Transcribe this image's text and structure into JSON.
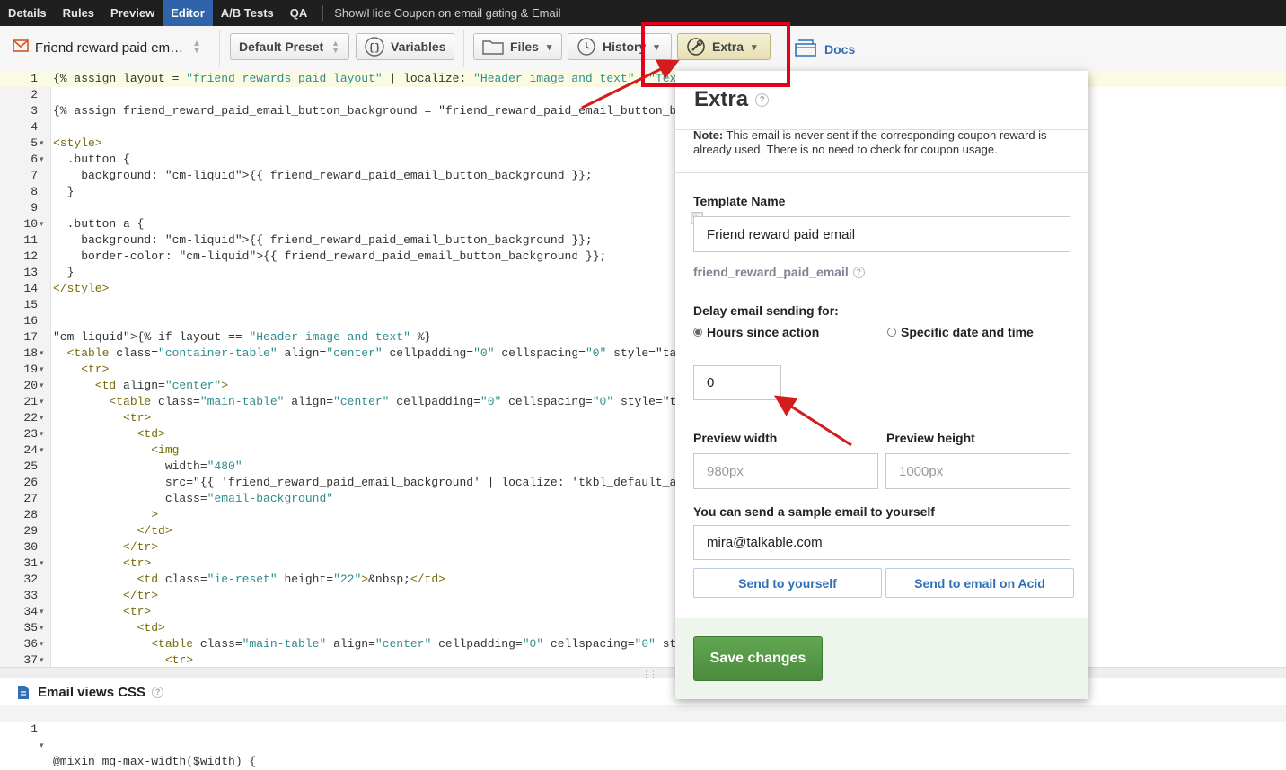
{
  "topnav": {
    "tabs": [
      "Details",
      "Rules",
      "Preview",
      "Editor",
      "A/B Tests",
      "QA"
    ],
    "active": "Editor",
    "campaign_title": "Show/Hide Coupon on email gating & Email"
  },
  "toolbar": {
    "template_select": "Friend reward paid em…",
    "preset_label": "Default Preset",
    "variables_label": "Variables",
    "files_label": "Files",
    "history_label": "History",
    "extra_label": "Extra",
    "docs_label": "Docs"
  },
  "editor": {
    "lines": [
      {
        "n": 1,
        "fold": false,
        "code": "{% assign layout = \"friend_rewards_paid_layout\" | localize: \"Header image and text\", \"Text only\""
      },
      {
        "n": 2,
        "fold": false,
        "code": ""
      },
      {
        "n": 3,
        "fold": false,
        "code": "{% assign friend_reward_paid_email_button_background = \"friend_reward_paid_email_button_backgroun"
      },
      {
        "n": 4,
        "fold": false,
        "code": ""
      },
      {
        "n": 5,
        "fold": true,
        "code": "<style>"
      },
      {
        "n": 6,
        "fold": true,
        "code": "  .button {"
      },
      {
        "n": 7,
        "fold": false,
        "code": "    background: {{ friend_reward_paid_email_button_background }};"
      },
      {
        "n": 8,
        "fold": false,
        "code": "  }"
      },
      {
        "n": 9,
        "fold": false,
        "code": ""
      },
      {
        "n": 10,
        "fold": true,
        "code": "  .button a {"
      },
      {
        "n": 11,
        "fold": false,
        "code": "    background: {{ friend_reward_paid_email_button_background }};"
      },
      {
        "n": 12,
        "fold": false,
        "code": "    border-color: {{ friend_reward_paid_email_button_background }};"
      },
      {
        "n": 13,
        "fold": false,
        "code": "  }"
      },
      {
        "n": 14,
        "fold": false,
        "code": "</style>"
      },
      {
        "n": 15,
        "fold": false,
        "code": ""
      },
      {
        "n": 16,
        "fold": false,
        "code": ""
      },
      {
        "n": 17,
        "fold": false,
        "code": "{% if layout == \"Header image and text\" %}"
      },
      {
        "n": 18,
        "fold": true,
        "code": "  <table class=\"container-table\" align=\"center\" cellpadding=\"0\" cellspacing=\"0\" style=\"table-layo"
      },
      {
        "n": 19,
        "fold": true,
        "code": "    <tr>"
      },
      {
        "n": 20,
        "fold": true,
        "code": "      <td align=\"center\">"
      },
      {
        "n": 21,
        "fold": true,
        "code": "        <table class=\"main-table\" align=\"center\" cellpadding=\"0\" cellspacing=\"0\" style=\"table-lay"
      },
      {
        "n": 22,
        "fold": true,
        "code": "          <tr>"
      },
      {
        "n": 23,
        "fold": true,
        "code": "            <td>"
      },
      {
        "n": 24,
        "fold": true,
        "code": "              <img"
      },
      {
        "n": 25,
        "fold": false,
        "code": "                width=\"480\""
      },
      {
        "n": 26,
        "fold": false,
        "code": "                src=\"{{ 'friend_reward_paid_email_background' | localize: 'tkbl_default_advocate-"
      },
      {
        "n": 27,
        "fold": false,
        "code": "                class=\"email-background\""
      },
      {
        "n": 28,
        "fold": false,
        "code": "              >"
      },
      {
        "n": 29,
        "fold": false,
        "code": "            </td>"
      },
      {
        "n": 30,
        "fold": false,
        "code": "          </tr>"
      },
      {
        "n": 31,
        "fold": true,
        "code": "          <tr>"
      },
      {
        "n": 32,
        "fold": false,
        "code": "            <td class=\"ie-reset\" height=\"22\">&nbsp;</td>"
      },
      {
        "n": 33,
        "fold": false,
        "code": "          </tr>"
      },
      {
        "n": 34,
        "fold": true,
        "code": "          <tr>"
      },
      {
        "n": 35,
        "fold": true,
        "code": "            <td>"
      },
      {
        "n": 36,
        "fold": true,
        "code": "              <table class=\"main-table\" align=\"center\" cellpadding=\"0\" cellspacing=\"0\" style=\"tab"
      },
      {
        "n": 37,
        "fold": true,
        "code": "                <tr>"
      }
    ]
  },
  "css_section": {
    "title": "Email views CSS",
    "first_line_number": "1",
    "first_line": "@mixin mq-max-width($width) {"
  },
  "extra_panel": {
    "title": "Extra",
    "note_label": "Note:",
    "note_text": " This email is never sent if the corresponding coupon reward is already used. There is no need to check for coupon usage.",
    "template_name_label": "Template Name",
    "template_name_value": "Friend reward paid email",
    "template_slug": "friend_reward_paid_email",
    "delay_label": "Delay email sending for:",
    "radio_hours": "Hours since action",
    "radio_specific": "Specific date and time",
    "hours_value": "0",
    "preview_width_label": "Preview width",
    "preview_width_placeholder": "980px",
    "preview_height_label": "Preview height",
    "preview_height_placeholder": "1000px",
    "sample_label": "You can send a sample email to yourself",
    "sample_email": "mira@talkable.com",
    "send_yourself_label": "Send to yourself",
    "send_acid_label": "Send to email on Acid",
    "save_label": "Save changes"
  },
  "colors": {
    "accent_blue": "#2f65a8",
    "annotation_red": "#e3001b",
    "save_green": "#4a8b3d"
  }
}
